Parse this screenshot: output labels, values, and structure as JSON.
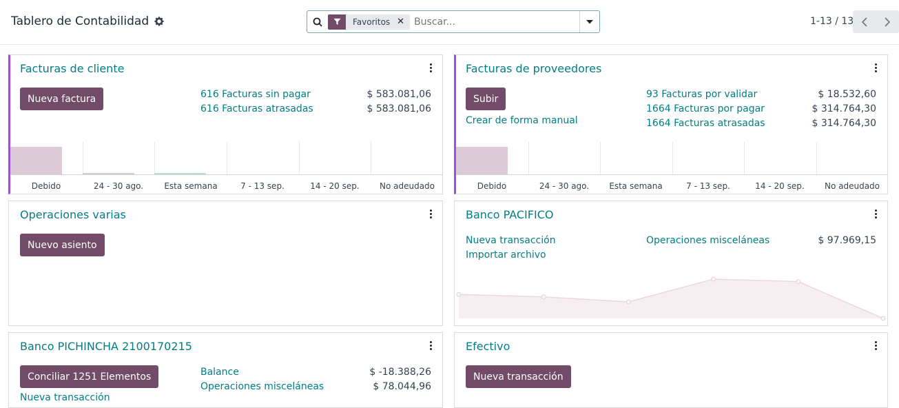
{
  "header": {
    "title": "Tablero de Contabilidad",
    "search": {
      "facet": "Favoritos",
      "placeholder": "Buscar..."
    },
    "pager": "1-13 / 13"
  },
  "cards": {
    "customer_invoices": {
      "title": "Facturas de cliente",
      "button": "Nueva factura",
      "rows": [
        {
          "label": "616 Facturas sin pagar",
          "amount": "$ 583.081,06"
        },
        {
          "label": "616 Facturas atrasadas",
          "amount": "$ 583.081,06"
        }
      ],
      "chart_labels": [
        "Debido",
        "24 - 30 ago.",
        "Esta semana",
        "7 - 13 sep.",
        "14 - 20 sep.",
        "No adeudado"
      ]
    },
    "vendor_bills": {
      "title": "Facturas de proveedores",
      "button": "Subir",
      "manual_link": "Crear de forma manual",
      "rows": [
        {
          "label": "93 Facturas por validar",
          "amount": "$ 18.532,60"
        },
        {
          "label": "1664 Facturas por pagar",
          "amount": "$ 314.764,30"
        },
        {
          "label": "1664 Facturas atrasadas",
          "amount": "$ 314.764,30"
        }
      ],
      "chart_labels": [
        "Debido",
        "24 - 30 ago.",
        "Esta semana",
        "7 - 13 sep.",
        "14 - 20 sep.",
        "No adeudado"
      ]
    },
    "misc_operations": {
      "title": "Operaciones varias",
      "button": "Nuevo asiento"
    },
    "bank_pacifico": {
      "title": "Banco PACIFICO",
      "links": [
        "Nueva transacción",
        "Importar archivo"
      ],
      "row": {
        "label": "Operaciones misceláneas",
        "amount": "$ 97.969,15"
      }
    },
    "bank_pichincha": {
      "title": "Banco PICHINCHA 2100170215",
      "button": "Conciliar 1251 Elementos",
      "link_partial": "Nueva transacción",
      "rows": [
        {
          "label": "Balance",
          "amount": "$ -18.388,26"
        },
        {
          "label": "Operaciones misceláneas",
          "amount": "$ 78.044,96"
        }
      ]
    },
    "cash": {
      "title": "Efectivo",
      "button": "Nueva transacción"
    }
  },
  "chart_data": [
    {
      "type": "bar",
      "categories": [
        "Debido",
        "24 - 30 ago.",
        "Esta semana",
        "7 - 13 sep.",
        "14 - 20 sep.",
        "No adeudado"
      ],
      "values": [
        100,
        6,
        3,
        0,
        0,
        0
      ],
      "colors": [
        "#dccbd6",
        "#dccbd6",
        "#b8ded9",
        "#dccbd6",
        "#dccbd6",
        "#dccbd6"
      ]
    },
    {
      "type": "bar",
      "categories": [
        "Debido",
        "24 - 30 ago.",
        "Esta semana",
        "7 - 13 sep.",
        "14 - 20 sep.",
        "No adeudado"
      ],
      "values": [
        100,
        0,
        0,
        0,
        0,
        0
      ],
      "colors": [
        "#dccbd6",
        "#dccbd6",
        "#dccbd6",
        "#dccbd6",
        "#dccbd6",
        "#dccbd6"
      ]
    },
    {
      "type": "area",
      "values": [
        58,
        52,
        40,
        95,
        89,
        0
      ],
      "ylim": [
        0,
        100
      ],
      "color": "#f3e7ec"
    }
  ]
}
